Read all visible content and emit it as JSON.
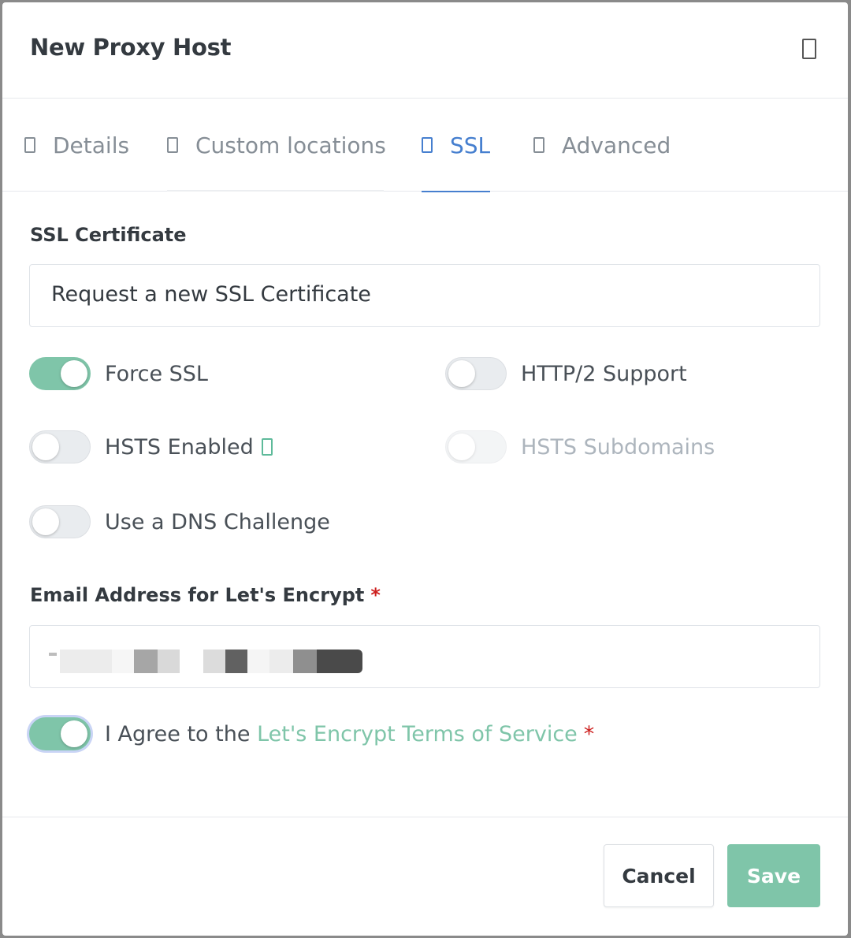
{
  "modal": {
    "title": "New Proxy Host"
  },
  "tabs": [
    {
      "label": "Details",
      "icon": "tab-icon"
    },
    {
      "label": "Custom locations",
      "icon": "tab-icon"
    },
    {
      "label": "SSL",
      "icon": "tab-icon",
      "active": true
    },
    {
      "label": "Advanced",
      "icon": "tab-icon"
    }
  ],
  "ssl": {
    "certificate_label": "SSL Certificate",
    "certificate_value": "Request a new SSL Certificate",
    "toggles": {
      "force_ssl": {
        "label": "Force SSL",
        "on": true
      },
      "http2": {
        "label": "HTTP/2 Support",
        "on": false
      },
      "hsts_enabled": {
        "label": "HSTS Enabled",
        "on": false
      },
      "hsts_subdomains": {
        "label": "HSTS Subdomains",
        "on": false,
        "disabled": true
      },
      "dns_challenge": {
        "label": "Use a DNS Challenge",
        "on": false
      }
    },
    "email_label": "Email Address for Let's Encrypt",
    "required_marker": "*",
    "agree_prefix": "I Agree to the ",
    "agree_link": "Let's Encrypt Terms of Service",
    "agree_on": true
  },
  "footer": {
    "cancel_label": "Cancel",
    "save_label": "Save"
  },
  "colors": {
    "accent_blue": "#467fcf",
    "accent_green": "#7fc5a9",
    "required_red": "#cd201f"
  }
}
